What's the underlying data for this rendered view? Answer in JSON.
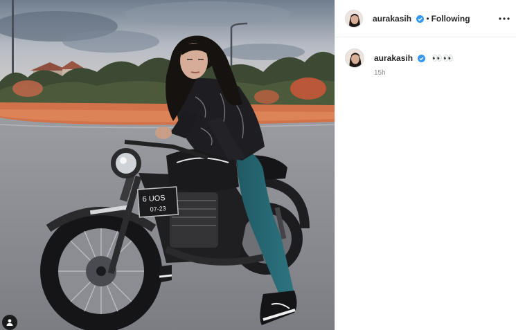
{
  "post": {
    "username": "aurakasih",
    "verified": true,
    "follow_status": "Following",
    "separator": "•",
    "caption_text": "👀👀",
    "time_ago": "15h",
    "colors": {
      "verified_badge": "#3897f0",
      "secondary_text": "#8e8e8e",
      "border": "#efefef"
    }
  },
  "photo": {
    "plate_line1": "6 UOS",
    "plate_line2": "07-23"
  },
  "icons": {
    "more": "more-horizontal-icon",
    "tag": "user-tag-icon",
    "verified": "verified-badge-icon"
  }
}
